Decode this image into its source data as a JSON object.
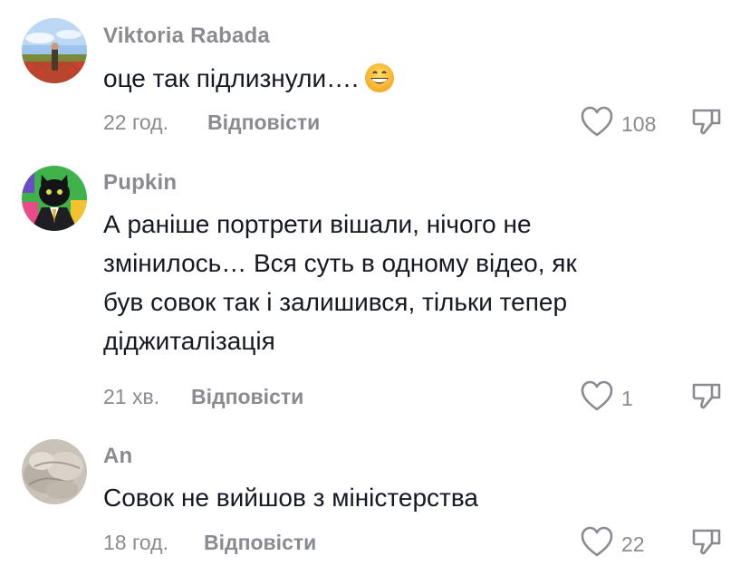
{
  "comments": [
    {
      "username": "Viktoria Rabada",
      "text": "оце так підлизнули….",
      "emoji": "grinning-face",
      "time": "22 год.",
      "reply_label": "Відповісти",
      "likes": "108"
    },
    {
      "username": "Pupkin",
      "text": "А раніше портрети вішали, нічого не змінилось… Вся суть в одному відео, як був совок так і залишився, тільки тепер діджиталізація",
      "time": "21 хв.",
      "reply_label": "Відповісти",
      "likes": "1"
    },
    {
      "username": "An",
      "text": "Совок не вийшов з міністерства",
      "time": "18 год.",
      "reply_label": "Відповісти",
      "likes": "22"
    }
  ],
  "colors": {
    "secondary_text": "#8a8b91",
    "primary_text": "#161823"
  }
}
